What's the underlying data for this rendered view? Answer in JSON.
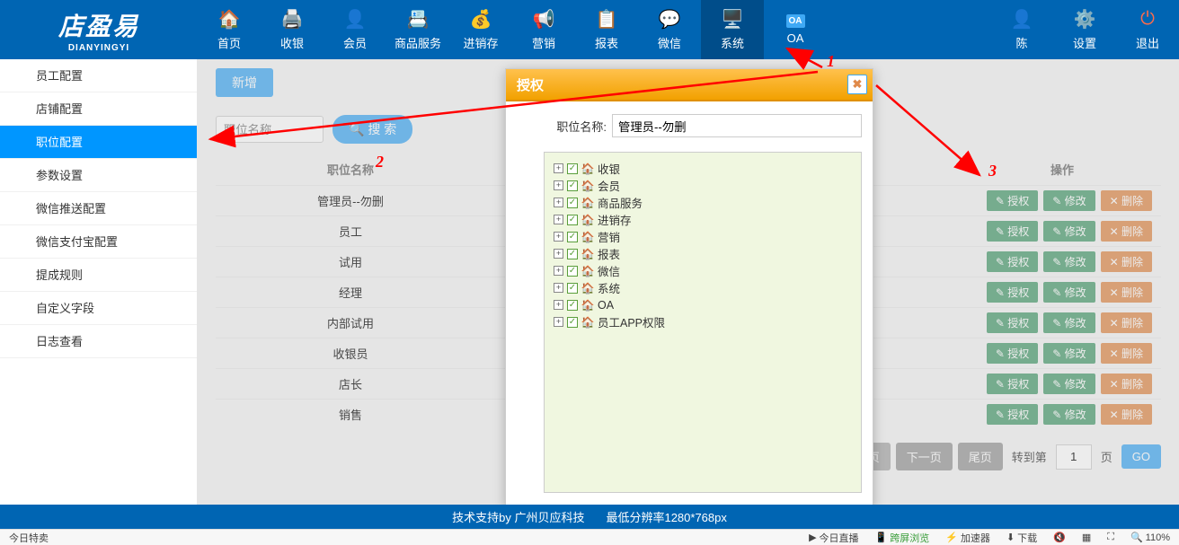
{
  "logo": {
    "cn": "店盈易",
    "en": "DIANYINGYI"
  },
  "nav": [
    {
      "label": "首页",
      "icon": "🏠"
    },
    {
      "label": "收银",
      "icon": "🖨️"
    },
    {
      "label": "会员",
      "icon": "👤"
    },
    {
      "label": "商品服务",
      "icon": "📇"
    },
    {
      "label": "进销存",
      "icon": "💰"
    },
    {
      "label": "营销",
      "icon": "📢"
    },
    {
      "label": "报表",
      "icon": "📋"
    },
    {
      "label": "微信",
      "icon": "💬"
    },
    {
      "label": "系统",
      "icon": "🖥️",
      "active": true
    },
    {
      "label": "OA",
      "icon": "OA"
    }
  ],
  "nav_right": [
    {
      "label": "陈",
      "icon": "👤"
    },
    {
      "label": "设置",
      "icon": "⚙️"
    },
    {
      "label": "退出",
      "icon": "⏻"
    }
  ],
  "sidebar": [
    {
      "label": "员工配置"
    },
    {
      "label": "店铺配置"
    },
    {
      "label": "职位配置",
      "active": true
    },
    {
      "label": "参数设置"
    },
    {
      "label": "微信推送配置"
    },
    {
      "label": "微信支付宝配置"
    },
    {
      "label": "提成规则"
    },
    {
      "label": "自定义字段"
    },
    {
      "label": "日志查看"
    }
  ],
  "toolbar": {
    "add": "新增",
    "search_placeholder": "职位名称",
    "search": "搜 索"
  },
  "table": {
    "header_name": "职位名称",
    "header_ops": "操作",
    "rows": [
      {
        "name": "管理员--勿删"
      },
      {
        "name": "员工"
      },
      {
        "name": "试用"
      },
      {
        "name": "经理"
      },
      {
        "name": "内部试用"
      },
      {
        "name": "收银员"
      },
      {
        "name": "店长"
      },
      {
        "name": "销售"
      }
    ],
    "btn_auth": "授权",
    "btn_edit": "修改",
    "btn_del": "删除"
  },
  "pager": {
    "prev": "下一页",
    "last": "尾页",
    "goto_label": "转到第",
    "page": "1",
    "page_suffix": "页",
    "go": "GO",
    "hidden_btn": "页"
  },
  "modal": {
    "title": "授权",
    "field_label": "职位名称:",
    "field_value": "管理员--勿删",
    "tree": [
      {
        "label": "收银"
      },
      {
        "label": "会员"
      },
      {
        "label": "商品服务"
      },
      {
        "label": "进销存"
      },
      {
        "label": "营销"
      },
      {
        "label": "报表"
      },
      {
        "label": "微信"
      },
      {
        "label": "系统"
      },
      {
        "label": "OA"
      },
      {
        "label": "员工APP权限"
      }
    ]
  },
  "footer": {
    "support": "技术支持by 广州贝应科技",
    "res": "最低分辨率1280*768px"
  },
  "browser": {
    "left": "今日特卖",
    "items": [
      "今日直播",
      "跨屏浏览",
      "加速器",
      "下载",
      "",
      "",
      "",
      "110%"
    ]
  },
  "anno": {
    "n1": "1",
    "n2": "2",
    "n3": "3"
  }
}
